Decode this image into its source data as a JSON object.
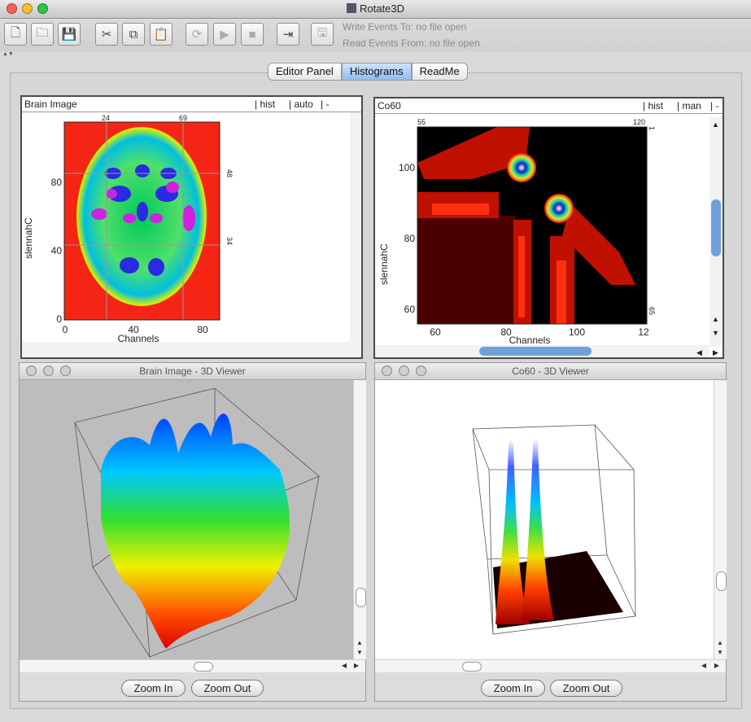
{
  "window": {
    "title": "Rotate3D"
  },
  "toolbar": {
    "buttons": [
      {
        "name": "new-file-icon",
        "glyph": "🗋",
        "dim": false
      },
      {
        "name": "open-folder-icon",
        "glyph": "🗀",
        "dim": false
      },
      {
        "name": "save-icon",
        "glyph": "💾",
        "dim": false
      },
      {
        "name": "cut-icon",
        "glyph": "✂",
        "dim": false
      },
      {
        "name": "copy-icon",
        "glyph": "⧉",
        "dim": false
      },
      {
        "name": "paste-icon",
        "glyph": "📋",
        "dim": false
      },
      {
        "name": "refresh-icon",
        "glyph": "⟳",
        "dim": true
      },
      {
        "name": "play-icon",
        "glyph": "▶",
        "dim": true
      },
      {
        "name": "stop-icon",
        "glyph": "■",
        "dim": true
      },
      {
        "name": "import-events-icon",
        "glyph": "⇥",
        "dim": false
      },
      {
        "name": "export-events-icon",
        "glyph": "🖫",
        "dim": true
      }
    ],
    "write_events": "Write Events To: no file open",
    "read_events": "Read Events From: no file open"
  },
  "tabs": [
    {
      "label": "Editor Panel",
      "active": false
    },
    {
      "label": "Histograms",
      "active": true
    },
    {
      "label": "ReadMe",
      "active": false
    }
  ],
  "hist_left": {
    "name": "Brain Image",
    "controls": [
      "| hist",
      "| auto",
      "| -"
    ],
    "xlabel": "Channels",
    "ylabel": "slennahC",
    "xticks": [
      "0",
      "40",
      "80"
    ],
    "yticks": [
      "0",
      "40",
      "80"
    ],
    "top_ticks": [
      "24",
      "69"
    ],
    "right_ticks": [
      "48",
      "34"
    ]
  },
  "hist_right": {
    "name": "Co60",
    "controls": [
      "| hist",
      "| man",
      "| -"
    ],
    "xlabel": "Channels",
    "ylabel": "slennahC",
    "xticks": [
      "60",
      "80",
      "100",
      "12"
    ],
    "yticks": [
      "60",
      "80",
      "100"
    ],
    "top_ticks": [
      "55",
      "120"
    ],
    "right_ticks": [
      "1",
      "65"
    ]
  },
  "viewer_left": {
    "title": "Brain Image - 3D Viewer",
    "zoom_in": "Zoom In",
    "zoom_out": "Zoom Out"
  },
  "viewer_right": {
    "title": "Co60 - 3D Viewer",
    "zoom_in": "Zoom In",
    "zoom_out": "Zoom Out"
  },
  "colors": {
    "tab_active": "#8fbdef",
    "scroll_thumb": "#6fa0dc"
  }
}
